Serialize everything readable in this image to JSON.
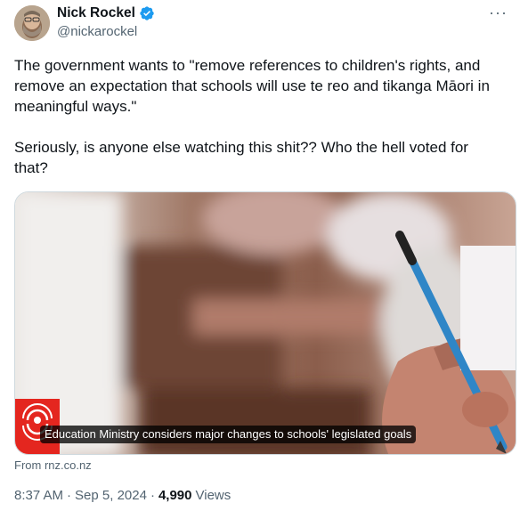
{
  "author": {
    "display_name": "Nick Rockel",
    "handle": "@nickarockel",
    "verified_icon": "verified-badge-icon",
    "avatar_icon": "avatar-photo"
  },
  "more_icon": "more-options-icon",
  "tweet": {
    "text": "The government wants to \"remove references to children's rights, and remove an expectation that schools will use te reo and tikanga Māori in meaningful ways.\"\n\nSeriously, is anyone else watching this shit?? Who the hell voted for that?"
  },
  "card": {
    "title": "Education Ministry considers major changes to schools' legislated goals",
    "source": "From rnz.co.nz",
    "logo_icon": "rnz-logo-icon"
  },
  "meta": {
    "time": "8:37 AM",
    "sep1": "·",
    "date": "Sep 5, 2024",
    "sep2": "·",
    "views_count": "4,990",
    "views_label": "Views"
  },
  "colors": {
    "verified": "#1d9bf0",
    "text": "#0f1419",
    "secondary": "#536471",
    "rnz_red": "#e4261f"
  }
}
